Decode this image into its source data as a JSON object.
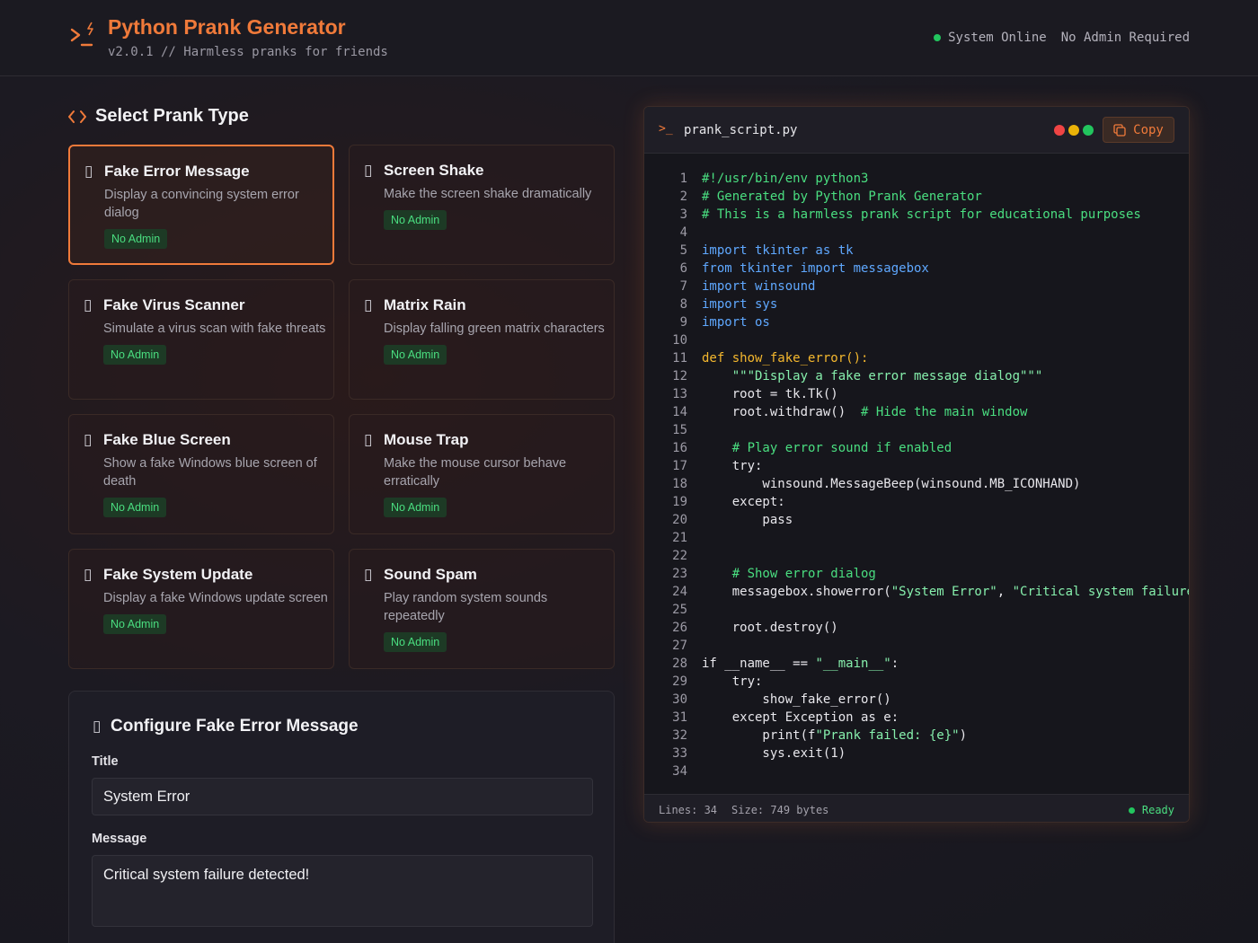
{
  "header": {
    "title": "Python Prank Generator",
    "subtitle": "v2.0.1 // Harmless pranks for friends",
    "status_online": "System Online",
    "status_admin": "No Admin Required"
  },
  "prank_section": {
    "title": "Select Prank Type",
    "cards": [
      {
        "title": "Fake Error Message",
        "desc": "Display a convincing system error dialog",
        "badge": "No Admin",
        "selected": true
      },
      {
        "title": "Screen Shake",
        "desc": "Make the screen shake dramatically",
        "badge": "No Admin"
      },
      {
        "title": "Fake Virus Scanner",
        "desc": "Simulate a virus scan with fake threats",
        "badge": "No Admin"
      },
      {
        "title": "Matrix Rain",
        "desc": "Display falling green matrix characters",
        "badge": "No Admin"
      },
      {
        "title": "Fake Blue Screen",
        "desc": "Show a fake Windows blue screen of death",
        "badge": "No Admin"
      },
      {
        "title": "Mouse Trap",
        "desc": "Make the mouse cursor behave erratically",
        "badge": "No Admin"
      },
      {
        "title": "Fake System Update",
        "desc": "Display a fake Windows update screen",
        "badge": "No Admin"
      },
      {
        "title": "Sound Spam",
        "desc": "Play random system sounds repeatedly",
        "badge": "No Admin"
      }
    ]
  },
  "config": {
    "title": "Configure Fake Error Message",
    "title_label": "Title",
    "title_value": "System Error",
    "message_label": "Message",
    "message_value": "Critical system failure detected!"
  },
  "code": {
    "filename": "prank_script.py",
    "copy_label": "Copy",
    "lines": [
      [
        [
          "c-com",
          "#!/usr/bin/env python3"
        ]
      ],
      [
        [
          "c-com",
          "# Generated by Python Prank Generator"
        ]
      ],
      [
        [
          "c-com",
          "# This is a harmless prank script for educational purposes"
        ]
      ],
      [],
      [
        [
          "c-kw",
          "import tkinter as tk"
        ]
      ],
      [
        [
          "c-kw",
          "from tkinter import messagebox"
        ]
      ],
      [
        [
          "c-kw",
          "import winsound"
        ]
      ],
      [
        [
          "c-kw",
          "import sys"
        ]
      ],
      [
        [
          "c-kw",
          "import os"
        ]
      ],
      [],
      [
        [
          "c-def",
          "def show_fake_error():"
        ]
      ],
      [
        [
          "c-str",
          "    \"\"\"Display a fake error message dialog\"\"\""
        ]
      ],
      [
        [
          "c-txt",
          "    root = tk.Tk()"
        ]
      ],
      [
        [
          "c-txt",
          "    root.withdraw()  "
        ],
        [
          "c-com",
          "# Hide the main window"
        ]
      ],
      [],
      [
        [
          "c-com",
          "    # Play error sound if enabled"
        ]
      ],
      [
        [
          "c-txt",
          "    try:"
        ]
      ],
      [
        [
          "c-txt",
          "        winsound.MessageBeep(winsound.MB_ICONHAND)"
        ]
      ],
      [
        [
          "c-txt",
          "    except:"
        ]
      ],
      [
        [
          "c-txt",
          "        pass"
        ]
      ],
      [],
      [],
      [
        [
          "c-com",
          "    # Show error dialog"
        ]
      ],
      [
        [
          "c-txt",
          "    messagebox.showerror("
        ],
        [
          "c-str",
          "\"System Error\""
        ],
        [
          "c-txt",
          ", "
        ],
        [
          "c-str",
          "\"Critical system failure detected!\""
        ],
        [
          "c-txt",
          ")"
        ]
      ],
      [],
      [
        [
          "c-txt",
          "    root.destroy()"
        ]
      ],
      [],
      [
        [
          "c-txt",
          "if __name__ == "
        ],
        [
          "c-str",
          "\"__main__\""
        ],
        [
          "c-txt",
          ":"
        ]
      ],
      [
        [
          "c-txt",
          "    try:"
        ]
      ],
      [
        [
          "c-txt",
          "        show_fake_error()"
        ]
      ],
      [
        [
          "c-txt",
          "    except Exception as e:"
        ]
      ],
      [
        [
          "c-txt",
          "        print(f"
        ],
        [
          "c-str",
          "\"Prank failed: {e}\""
        ],
        [
          "c-txt",
          ")"
        ]
      ],
      [
        [
          "c-txt",
          "        sys.exit(1)"
        ]
      ],
      []
    ],
    "footer_lines": "Lines: 34",
    "footer_size": "Size: 749 bytes",
    "footer_status": "Ready"
  },
  "colors": {
    "accent": "#f07a3a",
    "success": "#22c55e",
    "dot_red": "#ef4444",
    "dot_yellow": "#eab308",
    "dot_green": "#22c55e"
  },
  "icons": {
    "logo": "terminal-bolt-icon",
    "section": "code-brackets-icon",
    "card": "square-icon",
    "copy": "copy-icon"
  }
}
